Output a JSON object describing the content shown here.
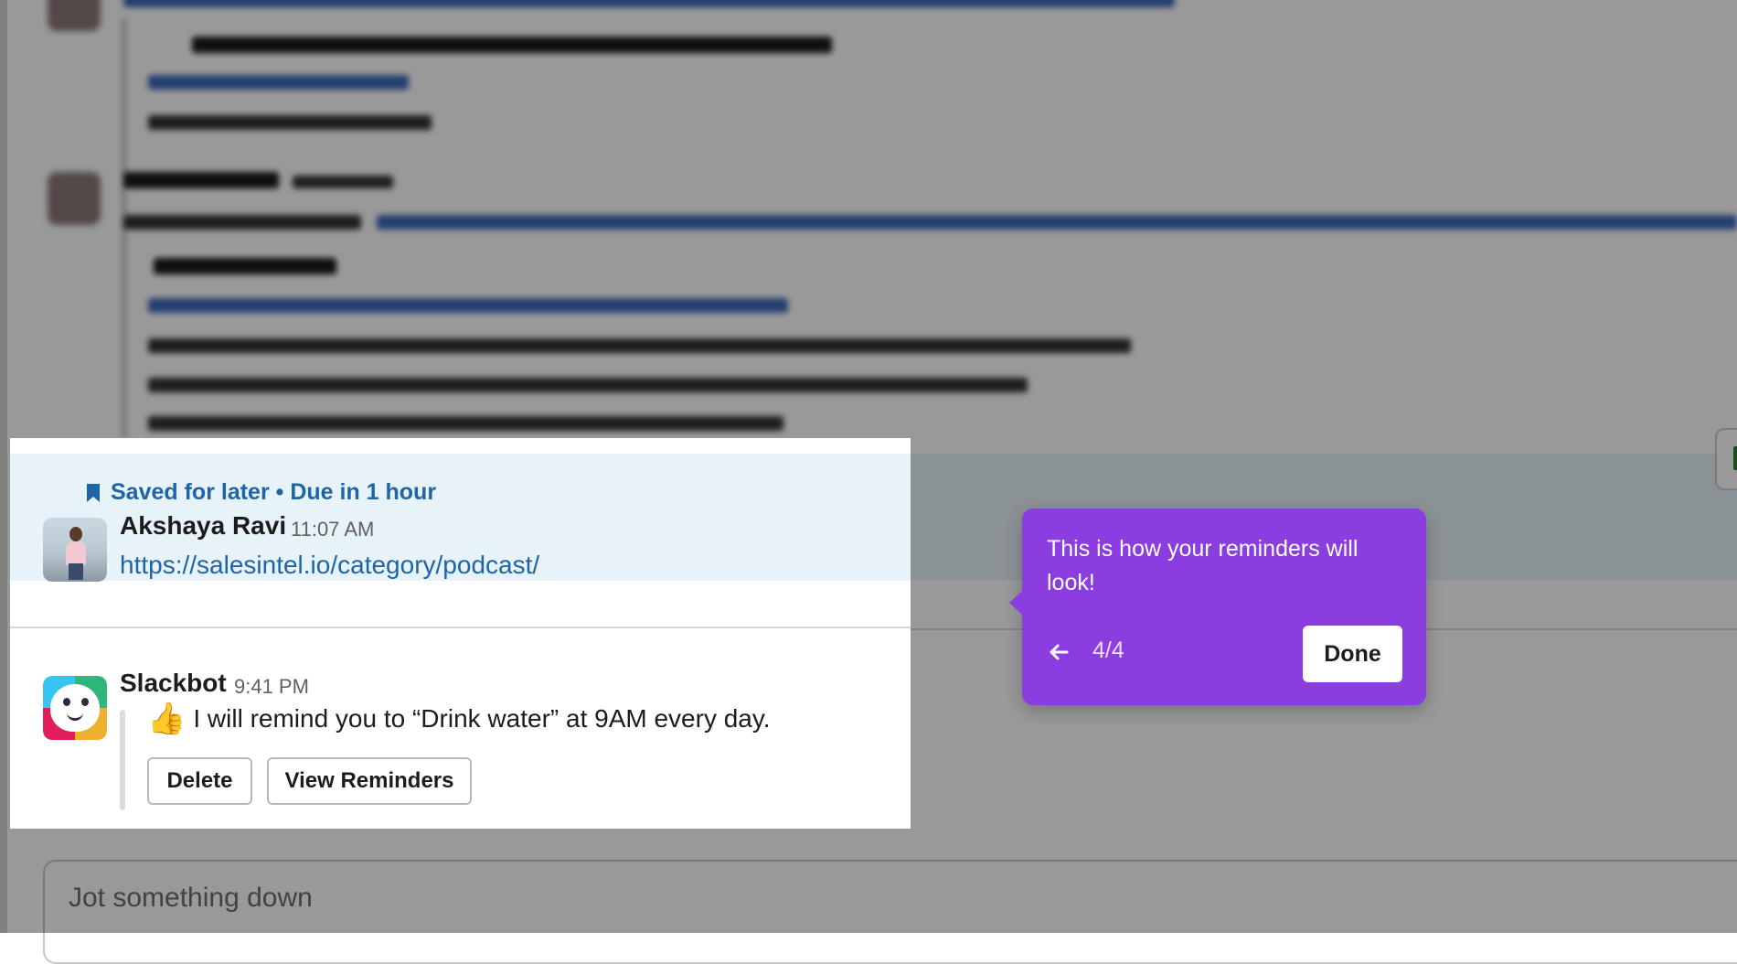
{
  "composer": {
    "placeholder": "Jot something down"
  },
  "saved_message": {
    "status": "Saved for later • Due in 1 hour",
    "author": "Akshaya Ravi",
    "time": "11:07 AM",
    "link": "https://salesintel.io/category/podcast/"
  },
  "slackbot_message": {
    "author": "Slackbot",
    "time": "9:41 PM",
    "emoji": "👍",
    "text": "I will remind you to “Drink water” at 9AM every day.",
    "delete_label": "Delete",
    "view_label": "View Reminders"
  },
  "tooltip": {
    "text": "This is how your reminders will look!",
    "step": "4/4",
    "done_label": "Done"
  },
  "colors": {
    "accent": "#8c3de0",
    "link": "#1d64a8",
    "highlight": "#e8f3f9"
  },
  "icons": [
    "bookmark-icon",
    "back-arrow-icon",
    "thumbs-up-icon"
  ]
}
